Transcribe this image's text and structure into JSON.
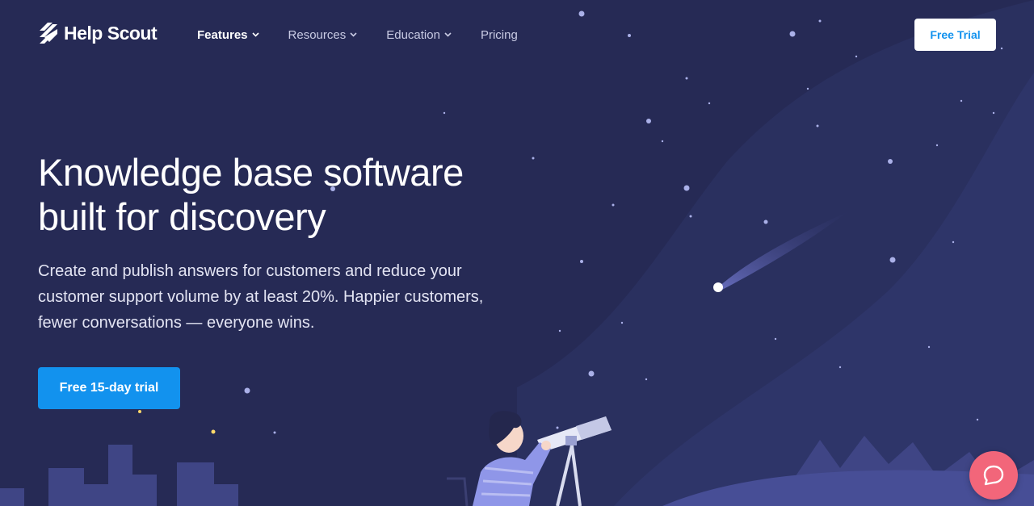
{
  "header": {
    "logo_text": "Help Scout",
    "nav": [
      {
        "label": "Features",
        "active": true,
        "has_dropdown": true
      },
      {
        "label": "Resources",
        "active": false,
        "has_dropdown": true
      },
      {
        "label": "Education",
        "active": false,
        "has_dropdown": true
      },
      {
        "label": "Pricing",
        "active": false,
        "has_dropdown": false
      }
    ],
    "cta_label": "Free Trial"
  },
  "hero": {
    "title_line1": "Knowledge base software",
    "title_line2": "built for discovery",
    "description_line1": "Create and publish answers for customers and reduce your",
    "description_line2": "customer support volume by at least 20%. Happier customers,",
    "description_line3": "fewer conversations — everyone wins.",
    "cta_label": "Free 15-day trial"
  },
  "beacon": {
    "icon": "chat-bubble-icon"
  },
  "colors": {
    "background": "#262a55",
    "accent": "#1292ee",
    "beacon": "#f2667a",
    "nav_text": "#c9cbe4"
  }
}
